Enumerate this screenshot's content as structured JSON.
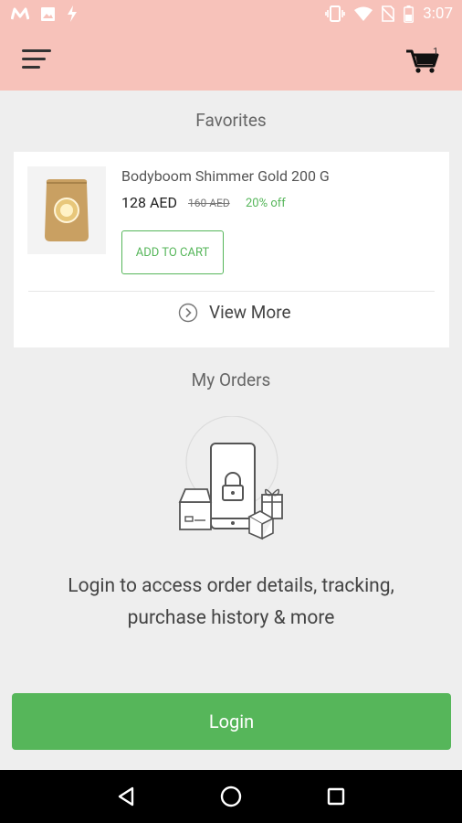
{
  "status_bar": {
    "time": "3:07",
    "left_icons": [
      "m-app-icon",
      "image-icon",
      "flash-icon"
    ],
    "right_icons": [
      "vibrate-icon",
      "wifi-icon",
      "no-sim-icon",
      "battery-icon"
    ]
  },
  "app_bar": {
    "background": "#f7c2ba",
    "cart_count": "1"
  },
  "favorites": {
    "title": "Favorites",
    "product": {
      "name": "Bodyboom Shimmer Gold 200 G",
      "price": "128 AED",
      "old_price": "160 AED",
      "discount": "20% off"
    },
    "add_to_cart_label": "ADD TO CART",
    "view_more_label": "View More"
  },
  "orders": {
    "title": "My Orders",
    "message_line1": "Login to access order details, tracking,",
    "message_line2": "purchase history & more",
    "login_label": "Login"
  },
  "colors": {
    "accent_green": "#56b65a",
    "header_pink": "#f7c2ba"
  }
}
